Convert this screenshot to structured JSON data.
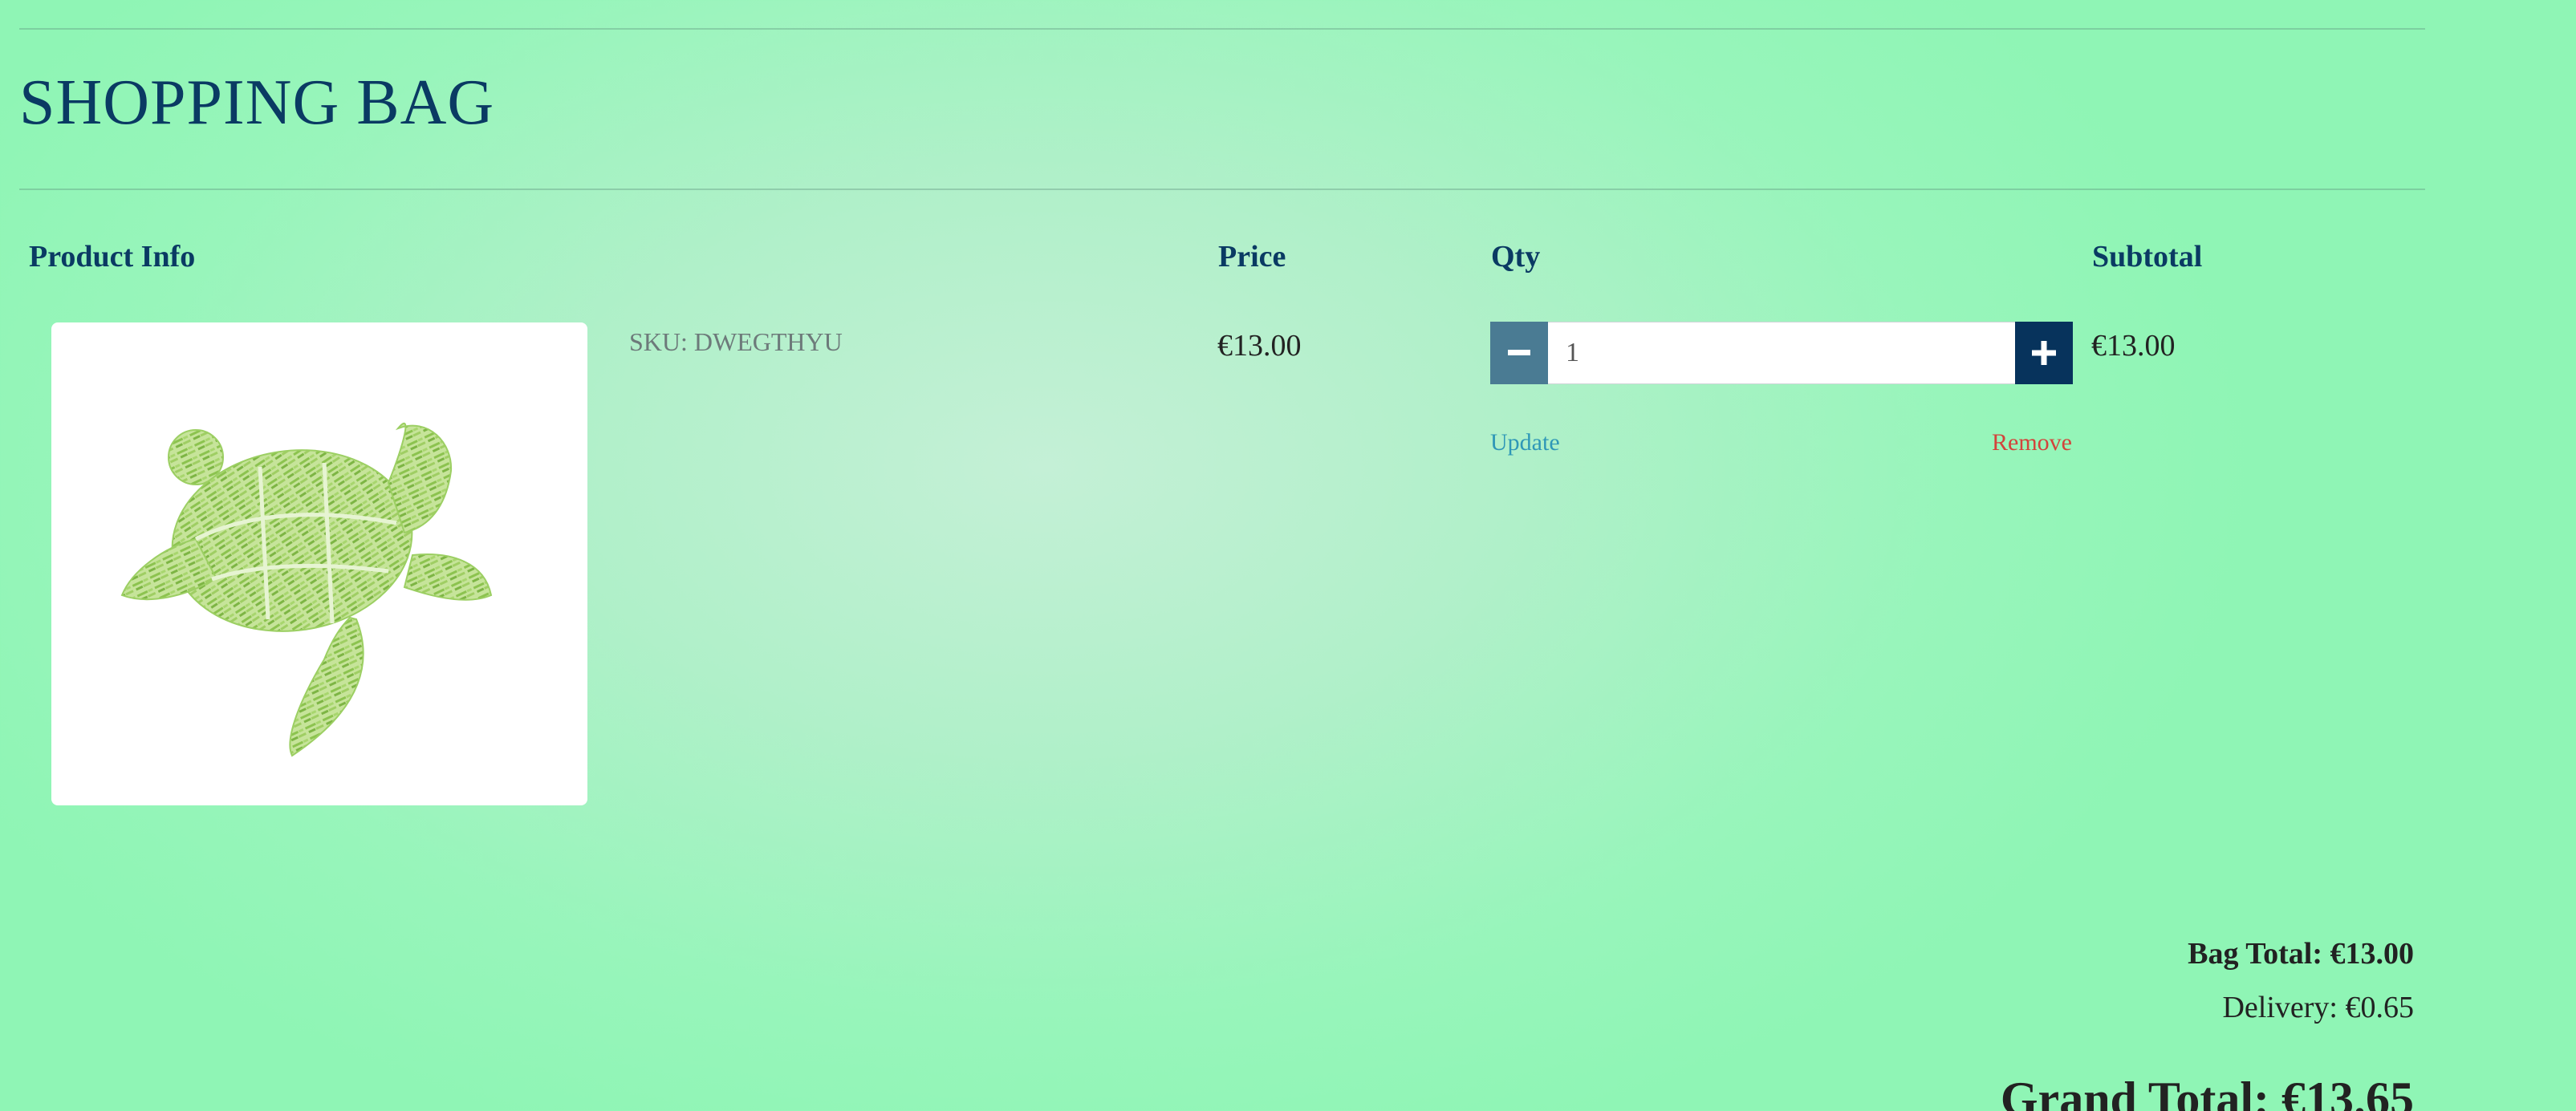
{
  "page": {
    "title": "SHOPPING BAG"
  },
  "table": {
    "headers": {
      "product_info": "Product Info",
      "price": "Price",
      "qty": "Qty",
      "subtotal": "Subtotal"
    }
  },
  "items": [
    {
      "image": "sea-turtle-word-cloud",
      "sku": "SKU: DWEGTHYU",
      "price": "€13.00",
      "qty": "1",
      "update_label": "Update",
      "remove_label": "Remove",
      "subtotal": "€13.00"
    }
  ],
  "summary": {
    "bag_total": "Bag Total: €13.00",
    "delivery": "Delivery: €0.65",
    "grand_total": "Grand Total: €13.65"
  },
  "icons": {
    "decrement": "minus-icon",
    "increment": "plus-icon"
  },
  "colors": {
    "heading": "#0a3a63",
    "minus_button": "#4a7b93",
    "plus_button": "#07335c",
    "update_link": "#2f97b7",
    "remove_link": "#d3433b",
    "background": "#a8f2c4"
  }
}
